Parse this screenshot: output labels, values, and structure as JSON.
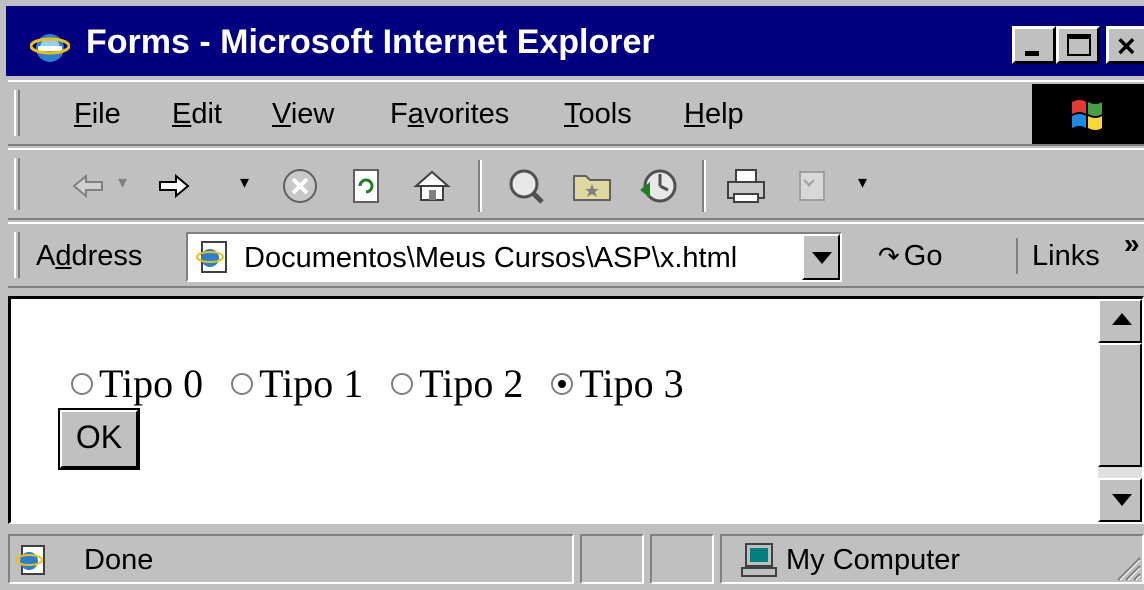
{
  "window": {
    "title": "Forms - Microsoft Internet Explorer",
    "title_bar_color": "#000080"
  },
  "menu": {
    "items": [
      {
        "label": "File",
        "accel": "F",
        "rest": "ile"
      },
      {
        "label": "Edit",
        "accel": "E",
        "rest": "dit"
      },
      {
        "label": "View",
        "accel": "V",
        "rest": "iew"
      },
      {
        "label": "Favorites",
        "pre": "F",
        "accel": "a",
        "rest": "vorites"
      },
      {
        "label": "Tools",
        "accel": "T",
        "rest": "ools"
      },
      {
        "label": "Help",
        "accel": "H",
        "rest": "elp"
      }
    ]
  },
  "toolbar": {
    "icons": [
      "back-icon",
      "forward-icon",
      "stop-icon",
      "refresh-icon",
      "home-icon",
      "search-icon",
      "favorites-icon",
      "history-icon",
      "print-icon",
      "edit-icon"
    ]
  },
  "address": {
    "label_pre": "A",
    "label_accel": "d",
    "label_rest": "dress",
    "value": "Documentos\\Meus Cursos\\ASP\\x.html",
    "go_label": "Go",
    "links_label": "Links",
    "chevron": "»"
  },
  "form": {
    "radios": [
      {
        "label": "Tipo 0",
        "checked": false
      },
      {
        "label": "Tipo 1",
        "checked": false
      },
      {
        "label": "Tipo 2",
        "checked": false
      },
      {
        "label": "Tipo 3",
        "checked": true
      }
    ],
    "ok_label": "OK"
  },
  "status": {
    "text": "Done",
    "zone": "My Computer"
  }
}
